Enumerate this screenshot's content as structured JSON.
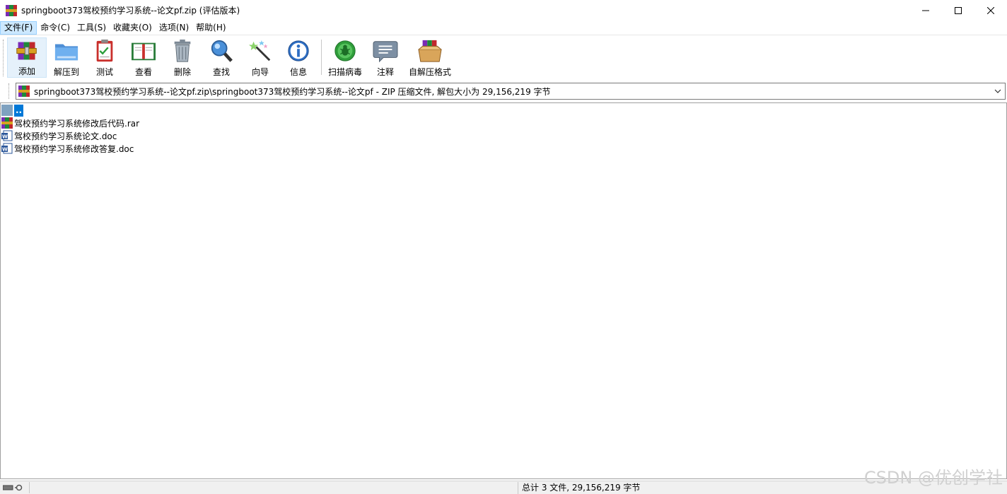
{
  "window": {
    "title": "springboot373驾校预约学习系统--论文pf.zip (评估版本)",
    "minimize_label": "minimize",
    "maximize_label": "maximize",
    "close_label": "close"
  },
  "menu": {
    "items": [
      {
        "label": "文件(F)"
      },
      {
        "label": "命令(C)"
      },
      {
        "label": "工具(S)"
      },
      {
        "label": "收藏夹(O)"
      },
      {
        "label": "选项(N)"
      },
      {
        "label": "帮助(H)"
      }
    ]
  },
  "toolbar": {
    "buttons": [
      {
        "label": "添加",
        "icon": "add-archive-icon"
      },
      {
        "label": "解压到",
        "icon": "extract-folder-icon"
      },
      {
        "label": "测试",
        "icon": "test-clipboard-icon"
      },
      {
        "label": "查看",
        "icon": "view-book-icon"
      },
      {
        "label": "删除",
        "icon": "trash-icon"
      },
      {
        "label": "查找",
        "icon": "magnifier-icon"
      },
      {
        "label": "向导",
        "icon": "wizard-wand-icon"
      },
      {
        "label": "信息",
        "icon": "info-icon"
      },
      {
        "label": "扫描病毒",
        "icon": "virus-scan-icon"
      },
      {
        "label": "注释",
        "icon": "comment-icon"
      },
      {
        "label": "自解压格式",
        "icon": "sfx-box-icon"
      }
    ]
  },
  "address": {
    "path": "springboot373驾校预约学习系统--论文pf.zip\\springboot373驾校预约学习系统--论文pf - ZIP 压缩文件, 解包大小为 29,156,219 字节"
  },
  "files": {
    "up": "..",
    "items": [
      {
        "name": "驾校预约学习系统修改后代码.rar",
        "type": "rar"
      },
      {
        "name": "驾校预约学习系统论文.doc",
        "type": "doc"
      },
      {
        "name": "驾校预约学习系统修改答复.doc",
        "type": "doc"
      }
    ]
  },
  "status": {
    "summary": "总计 3 文件, 29,156,219 字节"
  },
  "watermark": "CSDN @优创学社",
  "colors": {
    "selection": "#0078d7",
    "active_menu": "#cce8ff"
  }
}
